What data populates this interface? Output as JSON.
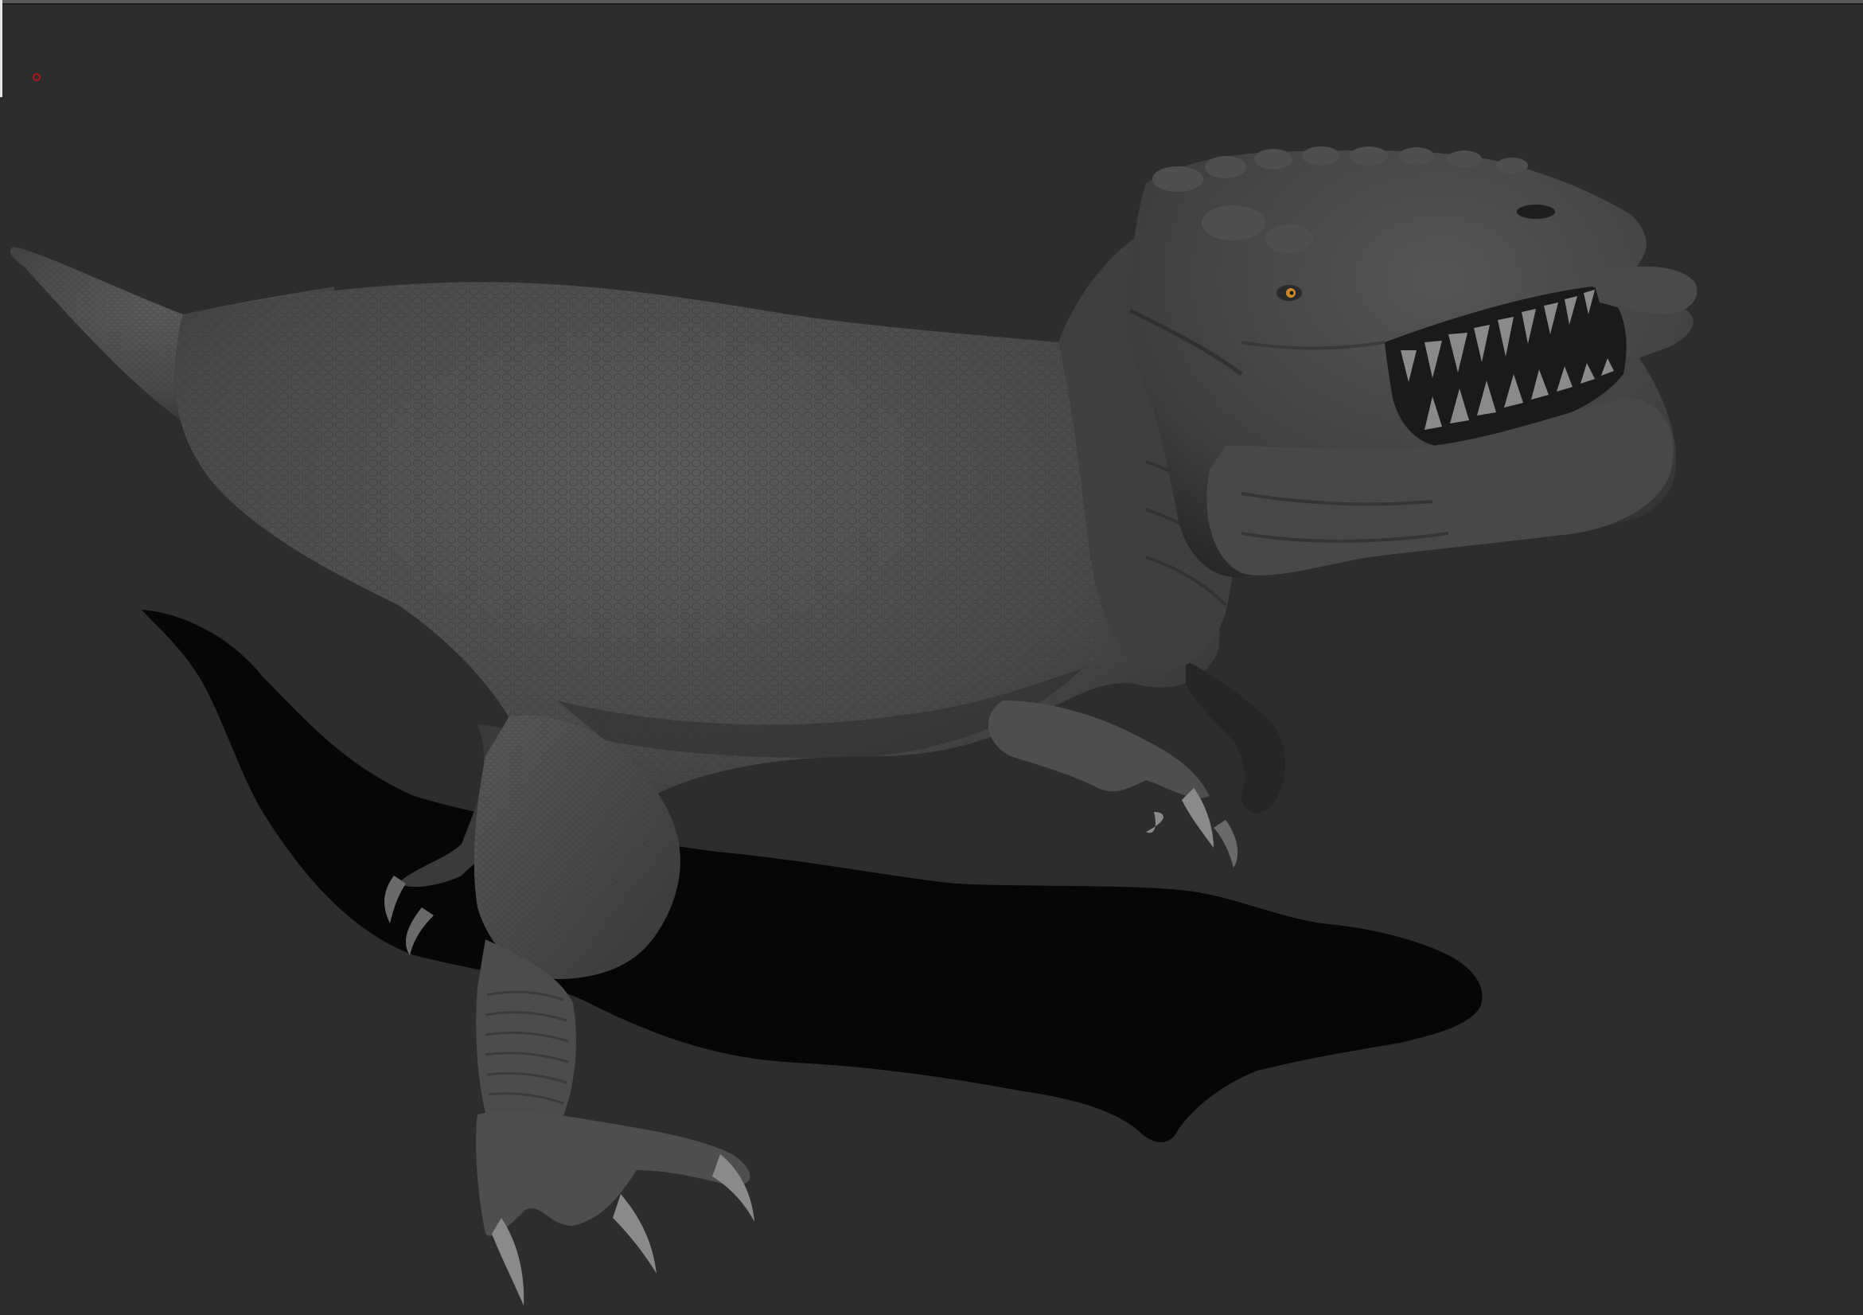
{
  "viewport": {
    "background": "#2d2d2d",
    "subject": "sculpted-dinosaur-model",
    "shadow_color": "#050505",
    "model_color": "#4a4a4a",
    "eye_color": "#d08a2a",
    "pivot_color": "#b01818"
  }
}
